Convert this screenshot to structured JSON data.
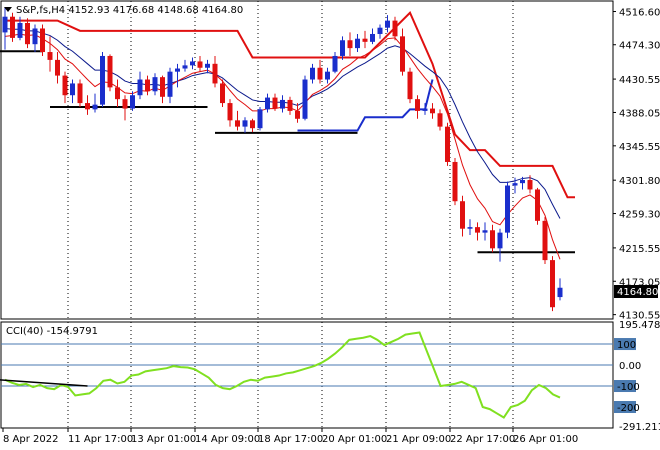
{
  "window": {
    "title": "S&P,fs,H4 4152.93 4176.68 4148.68 4164.80",
    "indicator_title": "CCI(40) -154.9791"
  },
  "price_axis": {
    "labels": [
      "4516.60",
      "4474.30",
      "4430.55",
      "4388.05",
      "4345.55",
      "4301.80",
      "4259.30",
      "4215.55",
      "4173.05",
      "4130.55"
    ],
    "current_price": "4164.80",
    "ylim": [
      4125,
      4530
    ]
  },
  "cci_axis": {
    "labels": [
      "195.4788",
      "100",
      "0.00",
      "-100",
      "-200",
      "-291.2113"
    ],
    "ylim": [
      -300,
      205
    ]
  },
  "time_axis": {
    "labels": [
      "8 Apr 2022",
      "11 Apr 17:00",
      "13 Apr 01:00",
      "14 Apr 09:00",
      "18 Apr 17:00",
      "20 Apr 01:00",
      "21 Apr 09:00",
      "22 Apr 17:00",
      "26 Apr 01:00"
    ]
  },
  "colors": {
    "bull": "#1a2ecc",
    "bear": "#e01010",
    "ma_fast": "#e01010",
    "ma_slow": "#0c1a8c",
    "cci": "#80e020",
    "grid": "#000000",
    "level_line": "#4a7ab0"
  },
  "chart_data": [
    {
      "type": "candlestick",
      "title": "S&P,fs,H4",
      "grid": true,
      "candles": [
        {
          "o": 4490,
          "h": 4522,
          "l": 4468,
          "c": 4510
        },
        {
          "o": 4510,
          "h": 4515,
          "l": 4478,
          "c": 4483
        },
        {
          "o": 4483,
          "h": 4510,
          "l": 4480,
          "c": 4502
        },
        {
          "o": 4502,
          "h": 4508,
          "l": 4470,
          "c": 4475
        },
        {
          "o": 4475,
          "h": 4500,
          "l": 4465,
          "c": 4495
        },
        {
          "o": 4495,
          "h": 4500,
          "l": 4460,
          "c": 4465
        },
        {
          "o": 4465,
          "h": 4485,
          "l": 4440,
          "c": 4455
        },
        {
          "o": 4455,
          "h": 4465,
          "l": 4425,
          "c": 4435
        },
        {
          "o": 4435,
          "h": 4440,
          "l": 4400,
          "c": 4410
        },
        {
          "o": 4410,
          "h": 4430,
          "l": 4400,
          "c": 4425
        },
        {
          "o": 4425,
          "h": 4430,
          "l": 4395,
          "c": 4400
        },
        {
          "o": 4400,
          "h": 4410,
          "l": 4385,
          "c": 4392
        },
        {
          "o": 4392,
          "h": 4412,
          "l": 4388,
          "c": 4398
        },
        {
          "o": 4398,
          "h": 4465,
          "l": 4395,
          "c": 4460
        },
        {
          "o": 4460,
          "h": 4462,
          "l": 4415,
          "c": 4420
        },
        {
          "o": 4420,
          "h": 4430,
          "l": 4395,
          "c": 4405
        },
        {
          "o": 4405,
          "h": 4410,
          "l": 4378,
          "c": 4393
        },
        {
          "o": 4393,
          "h": 4415,
          "l": 4390,
          "c": 4410
        },
        {
          "o": 4410,
          "h": 4440,
          "l": 4405,
          "c": 4430
        },
        {
          "o": 4430,
          "h": 4435,
          "l": 4410,
          "c": 4415
        },
        {
          "o": 4415,
          "h": 4438,
          "l": 4410,
          "c": 4433
        },
        {
          "o": 4433,
          "h": 4435,
          "l": 4400,
          "c": 4408
        },
        {
          "o": 4408,
          "h": 4445,
          "l": 4400,
          "c": 4440
        },
        {
          "o": 4440,
          "h": 4450,
          "l": 4420,
          "c": 4444
        },
        {
          "o": 4444,
          "h": 4455,
          "l": 4440,
          "c": 4448
        },
        {
          "o": 4448,
          "h": 4458,
          "l": 4443,
          "c": 4453
        },
        {
          "o": 4453,
          "h": 4460,
          "l": 4440,
          "c": 4445
        },
        {
          "o": 4445,
          "h": 4455,
          "l": 4438,
          "c": 4450
        },
        {
          "o": 4450,
          "h": 4460,
          "l": 4420,
          "c": 4425
        },
        {
          "o": 4425,
          "h": 4430,
          "l": 4395,
          "c": 4400
        },
        {
          "o": 4400,
          "h": 4405,
          "l": 4370,
          "c": 4378
        },
        {
          "o": 4378,
          "h": 4390,
          "l": 4365,
          "c": 4370
        },
        {
          "o": 4370,
          "h": 4382,
          "l": 4362,
          "c": 4378
        },
        {
          "o": 4378,
          "h": 4380,
          "l": 4363,
          "c": 4368
        },
        {
          "o": 4368,
          "h": 4395,
          "l": 4365,
          "c": 4392
        },
        {
          "o": 4392,
          "h": 4412,
          "l": 4388,
          "c": 4407
        },
        {
          "o": 4407,
          "h": 4412,
          "l": 4390,
          "c": 4393
        },
        {
          "o": 4393,
          "h": 4410,
          "l": 4388,
          "c": 4404
        },
        {
          "o": 4404,
          "h": 4408,
          "l": 4385,
          "c": 4390
        },
        {
          "o": 4390,
          "h": 4400,
          "l": 4375,
          "c": 4380
        },
        {
          "o": 4380,
          "h": 4435,
          "l": 4378,
          "c": 4430
        },
        {
          "o": 4430,
          "h": 4450,
          "l": 4425,
          "c": 4445
        },
        {
          "o": 4445,
          "h": 4455,
          "l": 4425,
          "c": 4430
        },
        {
          "o": 4430,
          "h": 4445,
          "l": 4425,
          "c": 4440
        },
        {
          "o": 4440,
          "h": 4465,
          "l": 4438,
          "c": 4460
        },
        {
          "o": 4460,
          "h": 4485,
          "l": 4455,
          "c": 4480
        },
        {
          "o": 4480,
          "h": 4490,
          "l": 4460,
          "c": 4470
        },
        {
          "o": 4470,
          "h": 4488,
          "l": 4465,
          "c": 4482
        },
        {
          "o": 4482,
          "h": 4492,
          "l": 4470,
          "c": 4478
        },
        {
          "o": 4478,
          "h": 4495,
          "l": 4475,
          "c": 4488
        },
        {
          "o": 4488,
          "h": 4500,
          "l": 4482,
          "c": 4496
        },
        {
          "o": 4496,
          "h": 4512,
          "l": 4490,
          "c": 4505
        },
        {
          "o": 4505,
          "h": 4510,
          "l": 4480,
          "c": 4485
        },
        {
          "o": 4485,
          "h": 4495,
          "l": 4435,
          "c": 4440
        },
        {
          "o": 4440,
          "h": 4445,
          "l": 4400,
          "c": 4405
        },
        {
          "o": 4405,
          "h": 4410,
          "l": 4380,
          "c": 4390
        },
        {
          "o": 4390,
          "h": 4400,
          "l": 4385,
          "c": 4393
        },
        {
          "o": 4393,
          "h": 4400,
          "l": 4380,
          "c": 4387
        },
        {
          "o": 4387,
          "h": 4392,
          "l": 4365,
          "c": 4370
        },
        {
          "o": 4370,
          "h": 4375,
          "l": 4320,
          "c": 4325
        },
        {
          "o": 4325,
          "h": 4330,
          "l": 4270,
          "c": 4275
        },
        {
          "o": 4275,
          "h": 4282,
          "l": 4230,
          "c": 4240
        },
        {
          "o": 4240,
          "h": 4252,
          "l": 4232,
          "c": 4242
        },
        {
          "o": 4242,
          "h": 4248,
          "l": 4225,
          "c": 4235
        },
        {
          "o": 4235,
          "h": 4248,
          "l": 4225,
          "c": 4238
        },
        {
          "o": 4238,
          "h": 4245,
          "l": 4210,
          "c": 4215
        },
        {
          "o": 4215,
          "h": 4240,
          "l": 4198,
          "c": 4235
        },
        {
          "o": 4235,
          "h": 4300,
          "l": 4228,
          "c": 4295
        },
        {
          "o": 4295,
          "h": 4305,
          "l": 4285,
          "c": 4298
        },
        {
          "o": 4298,
          "h": 4306,
          "l": 4290,
          "c": 4302
        },
        {
          "o": 4302,
          "h": 4308,
          "l": 4285,
          "c": 4290
        },
        {
          "o": 4290,
          "h": 4292,
          "l": 4245,
          "c": 4250
        },
        {
          "o": 4250,
          "h": 4255,
          "l": 4195,
          "c": 4200
        },
        {
          "o": 4200,
          "h": 4205,
          "l": 4135,
          "c": 4140
        },
        {
          "o": 4152.93,
          "h": 4176.68,
          "l": 4148.68,
          "c": 4164.8
        }
      ],
      "ma_fast": [
        4485,
        4486,
        4488,
        4486,
        4487,
        4482,
        4476,
        4468,
        4456,
        4450,
        4440,
        4430,
        4421,
        4427,
        4426,
        4420,
        4413,
        4412,
        4416,
        4415,
        4419,
        4416,
        4422,
        4428,
        4433,
        4438,
        4440,
        4442,
        4437,
        4428,
        4416,
        4405,
        4398,
        4390,
        4390,
        4393,
        4393,
        4395,
        4394,
        4390,
        4400,
        4411,
        4416,
        4422,
        4431,
        4443,
        4449,
        4457,
        4461,
        4467,
        4474,
        4482,
        4483,
        4472,
        4458,
        4444,
        4432,
        4421,
        4409,
        4386,
        4354,
        4321,
        4296,
        4278,
        4266,
        4249,
        4245,
        4258,
        4269,
        4279,
        4283,
        4276,
        4257,
        4226,
        4201
      ],
      "ma_slow": [
        4495,
        4494,
        4494,
        4492,
        4492,
        4489,
        4486,
        4480,
        4472,
        4466,
        4458,
        4450,
        4442,
        4442,
        4440,
        4435,
        4428,
        4425,
        4425,
        4423,
        4424,
        4422,
        4425,
        4428,
        4431,
        4435,
        4437,
        4439,
        4437,
        4432,
        4424,
        4416,
        4410,
        4404,
        4402,
        4402,
        4401,
        4401,
        4400,
        4397,
        4402,
        4409,
        4413,
        4418,
        4425,
        4434,
        4440,
        4446,
        4451,
        4457,
        4463,
        4470,
        4473,
        4470,
        4463,
        4455,
        4447,
        4440,
        4432,
        4418,
        4398,
        4376,
        4356,
        4338,
        4324,
        4309,
        4299,
        4299,
        4301,
        4304,
        4305,
        4301,
        4290,
        4271,
        4253
      ],
      "envelope_upper": [
        {
          "i": 0,
          "y": 4505
        },
        {
          "i": 7,
          "y": 4505
        },
        {
          "i": 10,
          "y": 4492
        },
        {
          "i": 31,
          "y": 4492
        },
        {
          "i": 33,
          "y": 4458
        },
        {
          "i": 48,
          "y": 4458
        },
        {
          "i": 54,
          "y": 4515
        },
        {
          "i": 57,
          "y": 4450
        },
        {
          "i": 60,
          "y": 4360
        },
        {
          "i": 62,
          "y": 4340
        },
        {
          "i": 64,
          "y": 4340
        },
        {
          "i": 66,
          "y": 4320
        },
        {
          "i": 73,
          "y": 4320
        },
        {
          "i": 75,
          "y": 4280
        },
        {
          "i": 76,
          "y": 4280
        }
      ],
      "envelope_lower": [
        {
          "i": 39,
          "y": 4365
        },
        {
          "i": 47,
          "y": 4365
        },
        {
          "i": 48,
          "y": 4382
        },
        {
          "i": 53,
          "y": 4382
        },
        {
          "i": 54,
          "y": 4392
        },
        {
          "i": 56,
          "y": 4392
        },
        {
          "i": 57,
          "y": 4430
        }
      ],
      "support_lines": [
        {
          "i1": 6,
          "i2": 27,
          "y": 4395
        },
        {
          "i1": 28,
          "i2": 47,
          "y": 4362
        },
        {
          "i1": 63,
          "i2": 76,
          "y": 4210
        },
        {
          "i1": -1,
          "i2": 5,
          "y": 4466
        }
      ]
    },
    {
      "type": "line",
      "title": "CCI(40) -154.9791",
      "levels": [
        100,
        0,
        -100
      ],
      "values": [
        -70,
        -85,
        -95,
        -90,
        -105,
        -95,
        -110,
        -115,
        -95,
        -105,
        -145,
        -140,
        -135,
        -110,
        -75,
        -70,
        -88,
        -80,
        -50,
        -45,
        -30,
        -25,
        -20,
        -15,
        -5,
        -10,
        -12,
        -20,
        -40,
        -60,
        -95,
        -110,
        -115,
        -100,
        -80,
        -70,
        -75,
        -60,
        -55,
        -50,
        -40,
        -35,
        -25,
        -15,
        -5,
        10,
        30,
        55,
        85,
        120,
        125,
        130,
        138,
        120,
        95,
        110,
        125,
        145,
        150,
        155,
        70,
        -15,
        -100,
        -95,
        -90,
        -80,
        -95,
        -110,
        -200,
        -210,
        -230,
        -250,
        -200,
        -190,
        -170,
        -120,
        -95,
        -110,
        -140,
        -155
      ],
      "trend_line": {
        "i1": -1,
        "v1": -70,
        "i2": 11,
        "v2": -100
      }
    }
  ]
}
